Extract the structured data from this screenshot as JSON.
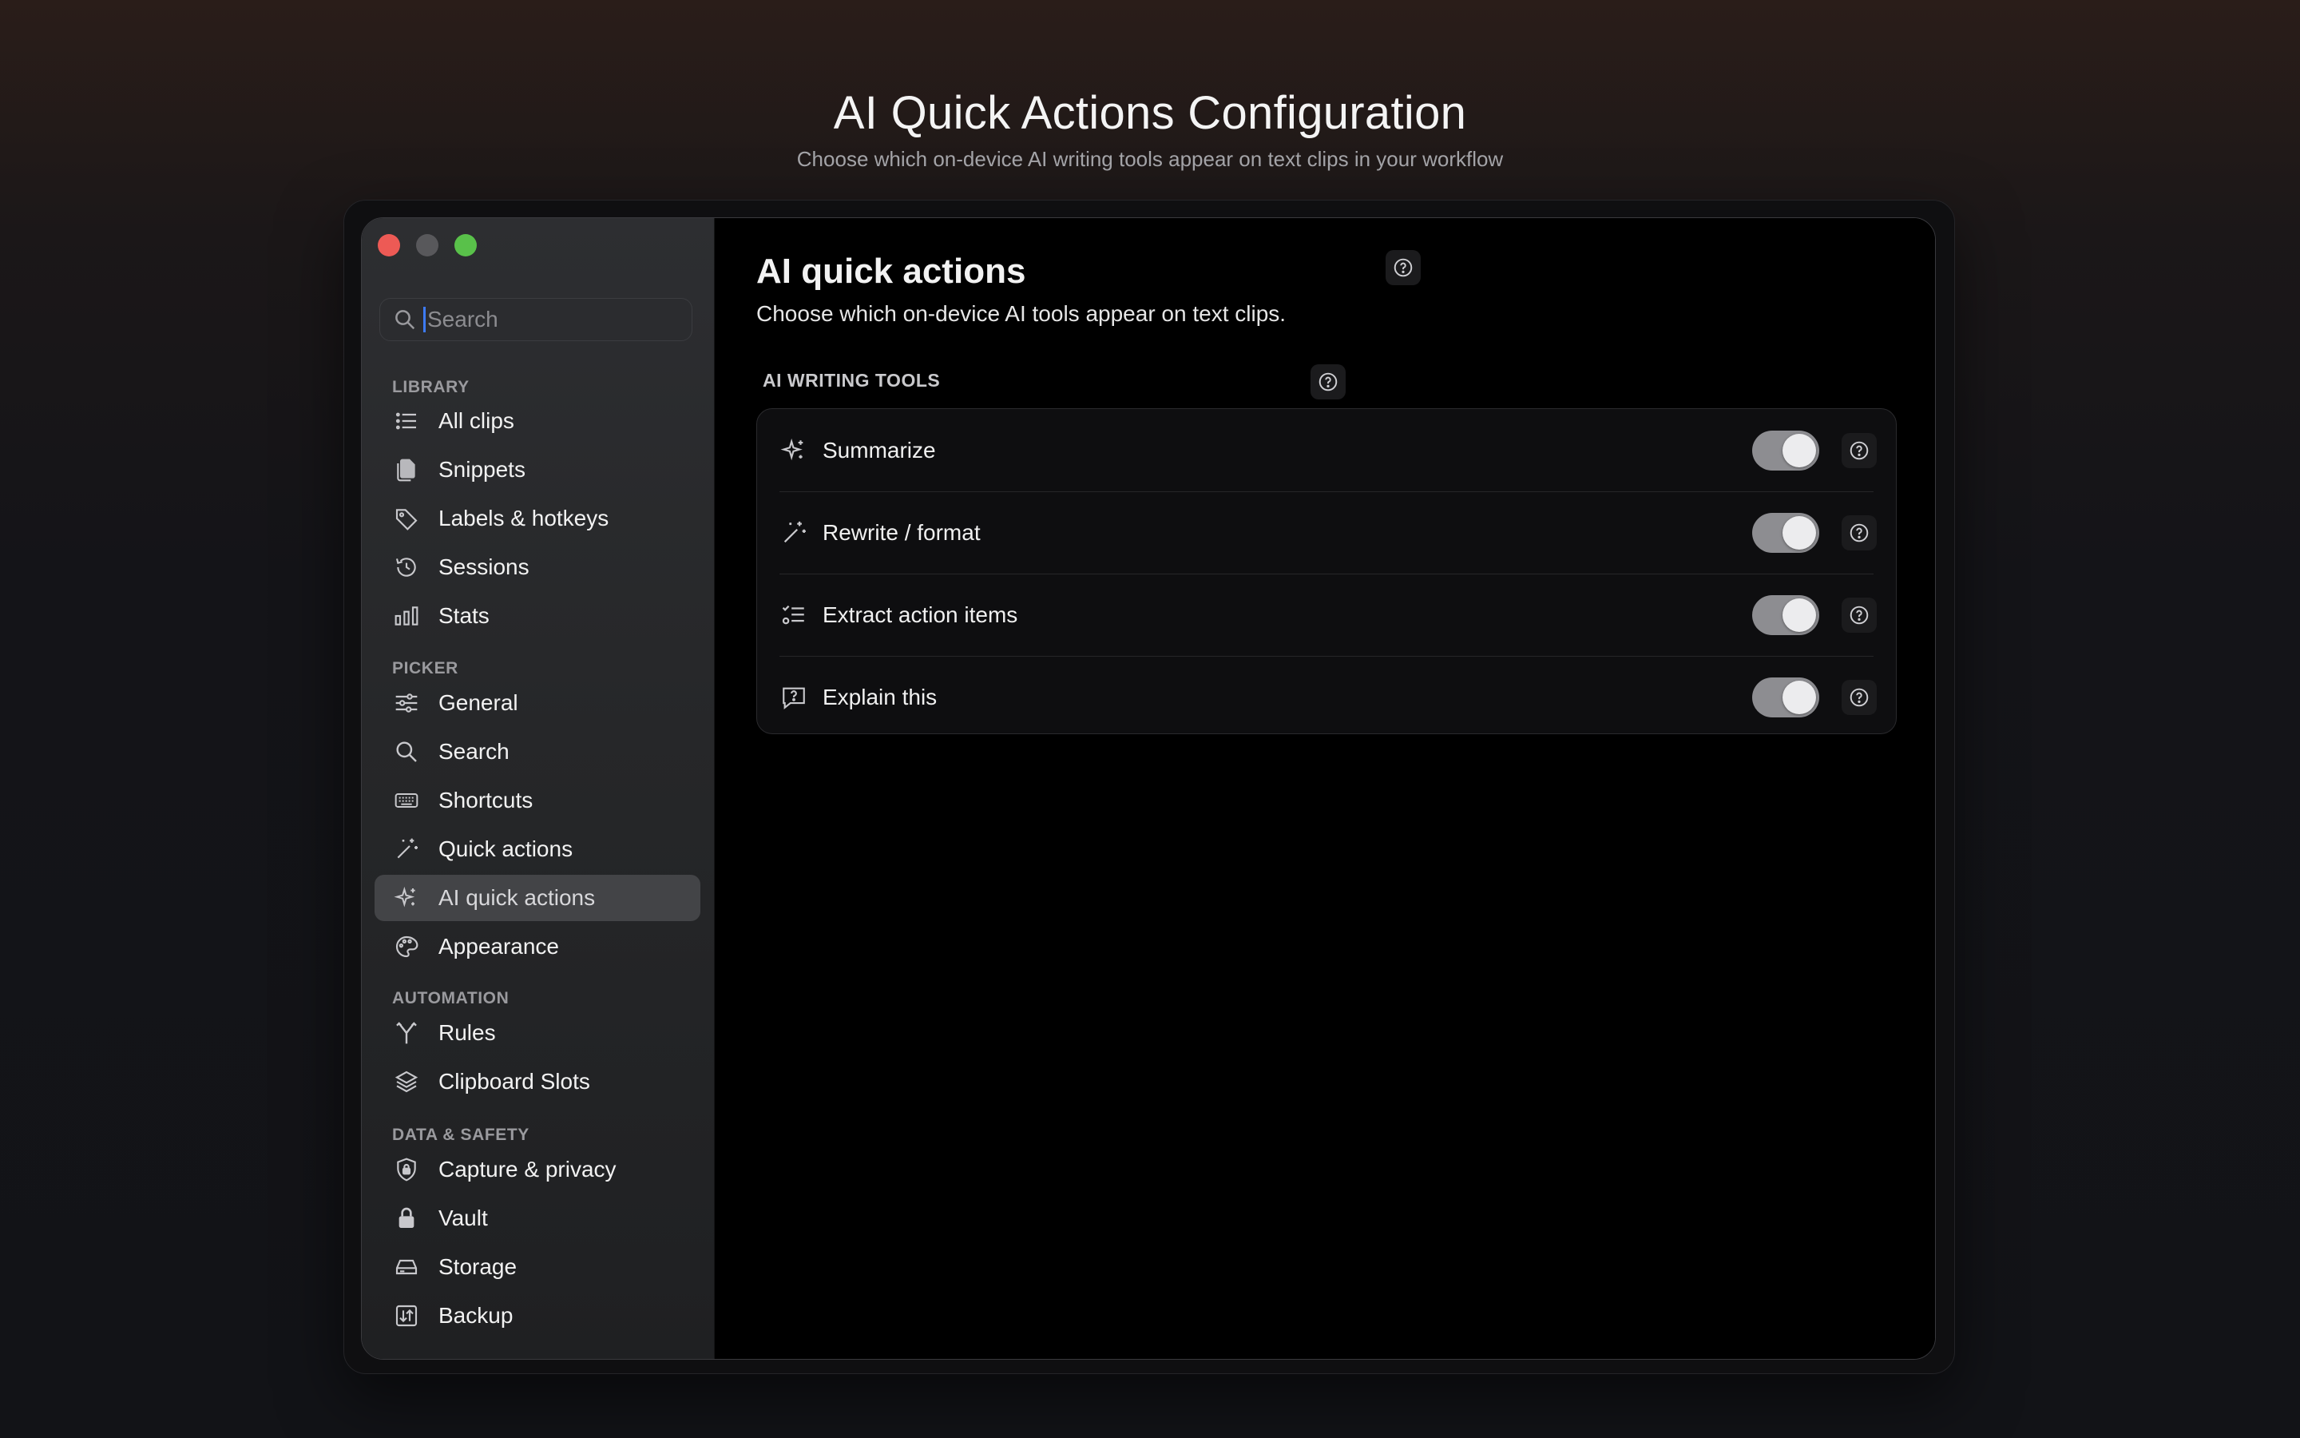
{
  "hero": {
    "title": "AI Quick Actions Configuration",
    "subtitle": "Choose which on-device AI writing tools appear on text clips in your workflow"
  },
  "sidebar": {
    "search_placeholder": "Search",
    "sections": {
      "library": "LIBRARY",
      "picker": "PICKER",
      "automation": "AUTOMATION",
      "data_safety": "DATA & SAFETY"
    },
    "items": {
      "all_clips": "All clips",
      "snippets": "Snippets",
      "labels_hotkeys": "Labels & hotkeys",
      "sessions": "Sessions",
      "stats": "Stats",
      "general": "General",
      "search": "Search",
      "shortcuts": "Shortcuts",
      "quick_actions": "Quick actions",
      "ai_quick_actions": "AI quick actions",
      "appearance": "Appearance",
      "rules": "Rules",
      "clipboard_slots": "Clipboard Slots",
      "capture_privacy": "Capture & privacy",
      "vault": "Vault",
      "storage": "Storage",
      "backup": "Backup"
    },
    "active_item": "AI quick actions"
  },
  "main": {
    "title": "AI quick actions",
    "subtitle": "Choose which on-device AI tools appear on text clips.",
    "group_label": "AI WRITING TOOLS",
    "tools": [
      {
        "label": "Summarize",
        "icon": "sparkles-icon",
        "enabled": true
      },
      {
        "label": "Rewrite / format",
        "icon": "magic-wand-icon",
        "enabled": true
      },
      {
        "label": "Extract action items",
        "icon": "checklist-icon",
        "enabled": true
      },
      {
        "label": "Explain this",
        "icon": "question-bubble-icon",
        "enabled": true
      }
    ]
  },
  "colors": {
    "close": "#ed5a55",
    "minimize": "#58585b",
    "zoom": "#59c14a",
    "toggle_track": "#8d8d91",
    "active_item_bg": "#434447",
    "caret": "#3d7bf7"
  }
}
